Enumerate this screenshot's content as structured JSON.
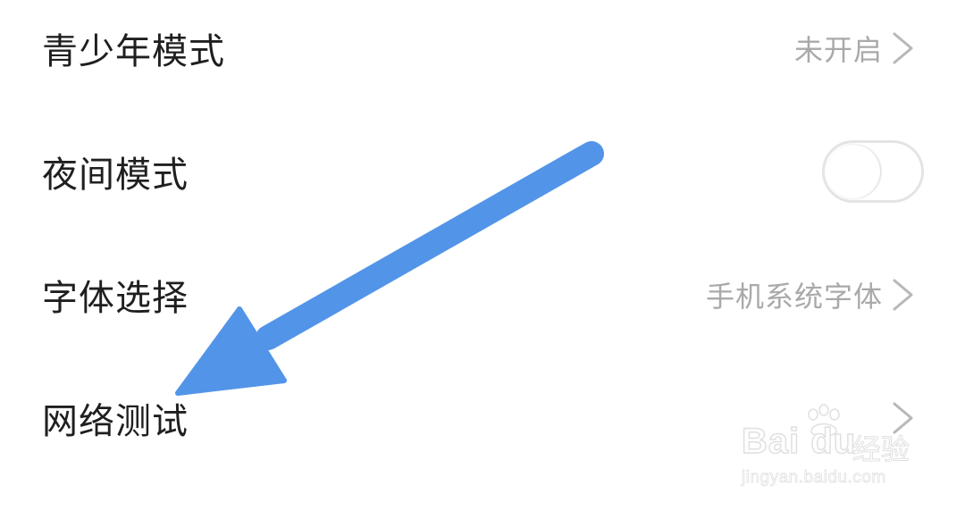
{
  "settings": {
    "items": [
      {
        "label": "青少年模式",
        "value": "未开启",
        "control": "chevron"
      },
      {
        "label": "夜间模式",
        "value": "",
        "control": "toggle",
        "toggle_on": false
      },
      {
        "label": "字体选择",
        "value": "手机系统字体",
        "control": "chevron"
      },
      {
        "label": "网络测试",
        "value": "",
        "control": "chevron"
      }
    ]
  },
  "annotation": {
    "arrow_color": "#5294e8",
    "points_to": "网络测试"
  },
  "watermark": {
    "brand": "Bai du",
    "product": "经验",
    "url": "jingyan.baidu.com"
  },
  "colors": {
    "label_text": "#1f1f1f",
    "value_text": "#a9a9a9",
    "chevron": "#b8b8b8",
    "toggle_border": "#e4e4e4",
    "background": "#ffffff"
  }
}
